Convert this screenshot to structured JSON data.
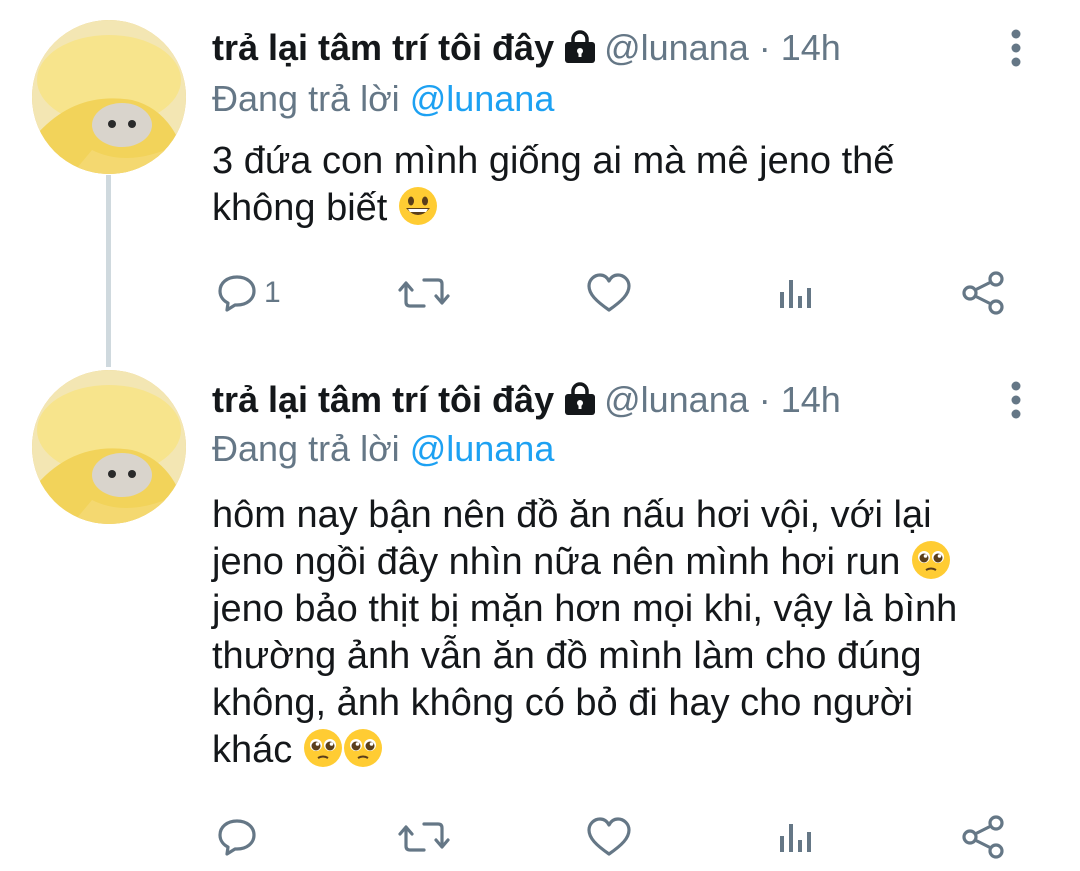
{
  "tweets": [
    {
      "author_name": "trả lại tâm trí tôi đây",
      "handle": "@lunana",
      "separator": "·",
      "time": "14h",
      "replying_prefix": "Đang trả lời",
      "replying_to": "@lunana",
      "text_lines": [
        "3 đứa con mình giống ai mà mê jeno thế",
        "không biết"
      ],
      "emojis": [
        "grinning-face"
      ],
      "reply_count": "1"
    },
    {
      "author_name": "trả lại tâm trí tôi đây",
      "handle": "@lunana",
      "separator": "·",
      "time": "14h",
      "replying_prefix": "Đang trả lời",
      "replying_to": "@lunana",
      "text_lines": [
        "hôm nay bận nên đồ ăn nấu hơi vội, với lại",
        "jeno ngồi đây nhìn nữa nên mình hơi run",
        "jeno bảo thịt bị mặn hơn mọi khi, vậy là bình",
        "thường ảnh vẫn ăn đồ mình làm cho đúng",
        "không, ảnh không có bỏ đi hay cho người",
        "khác"
      ],
      "emojis": [
        "pleading-face",
        "pleading-face",
        "pleading-face"
      ],
      "reply_count": ""
    }
  ],
  "icons": [
    "lock-icon",
    "more-icon",
    "reply-icon",
    "retweet-icon",
    "like-icon",
    "analytics-icon",
    "share-icon"
  ],
  "colors": {
    "text": "#14171a",
    "muted": "#657786",
    "link": "#1da1f2",
    "thread_line": "#cfd9de"
  }
}
